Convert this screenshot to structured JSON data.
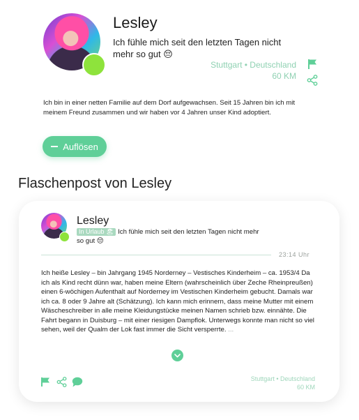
{
  "profile": {
    "name": "Lesley",
    "tagline": "Ich fühle mich seit den letzten Tagen nicht mehr so gut 😔",
    "location": "Stuttgart • Deutschland",
    "distance": "60 KM",
    "bio": "Ich bin in einer netten Familie auf dem Dorf aufgewachsen. Seit 15 Jahren bin ich mit meinem Freund zusammen und wir haben vor 4 Jahren unser Kind adoptiert.",
    "dissolve_label": "Auflösen"
  },
  "section_title": "Flaschenpost von Lesley",
  "card": {
    "name": "Lesley",
    "badge": "In Urlaub 🏖",
    "status_text": "Ich fühle mich seit den letzten Tagen nicht mehr so gut 😔",
    "time": "23:14 Uhr",
    "story": "Ich heiße Lesley – bin Jahrgang 1945  Norderney – Vestisches Kinderheim – ca. 1953/4  Da ich als Kind recht dünn war, haben meine Eltern (wahrscheinlich über Zeche Rheinpreußen) einen 6-wöchigen Aufenthalt auf Norderney im Vestischen Kinderheim gebucht. Damals war ich ca. 8 oder 9 Jahre alt (Schätzung). Ich kann mich erinnern, dass meine Mutter mit einem Wäscheschreiber in alle meine Kleidungstücke meinen Namen schrieb bzw. einnähte. Die Fahrt begann in Duisburg – mit einer riesigen Dampflok. Unterwegs konnte man nicht so viel sehen, weil der Qualm der Lok fast immer die Sicht versperrte.",
    "ellipsis": "...",
    "location": "Stuttgart • Deutschland",
    "distance": "60 KM"
  },
  "colors": {
    "accent": "#5fcf98",
    "accent_light": "#8fd1b2",
    "status_online": "#8ee33c"
  },
  "icons": [
    "flag-icon",
    "share-icon",
    "chat-icon",
    "chevron-down-icon"
  ]
}
